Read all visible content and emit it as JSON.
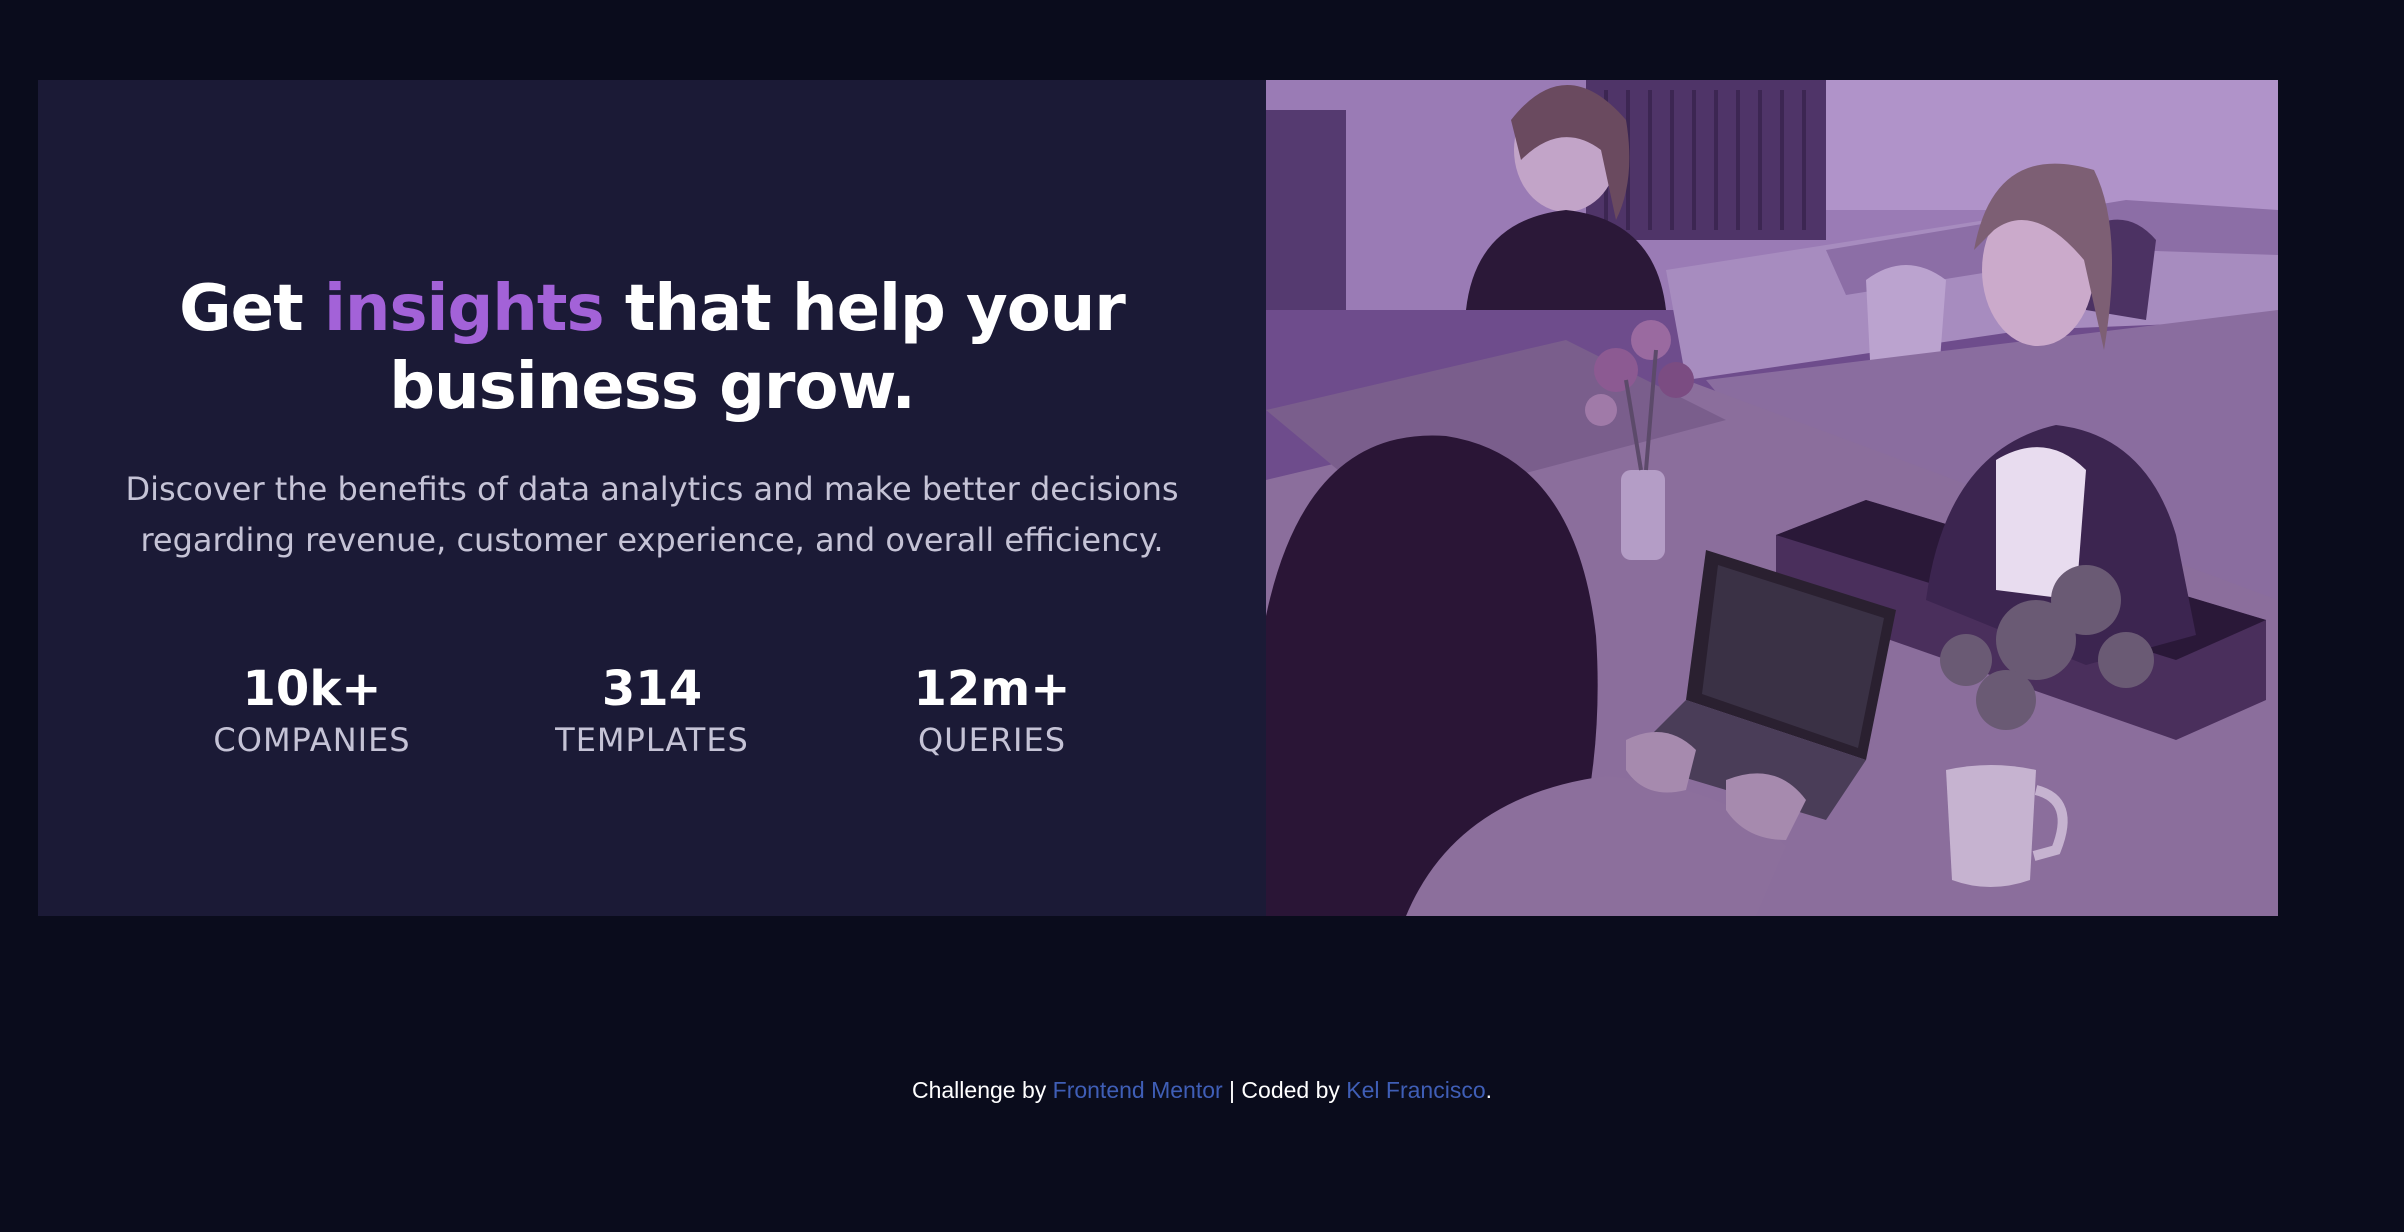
{
  "hero": {
    "headline_start": "Get ",
    "headline_accent": "insights",
    "headline_end": " that help your business grow.",
    "description": "Discover the benefits of data analytics and make better decisions regarding revenue, customer experience, and overall efficiency.",
    "accent_color": "#a362d8"
  },
  "stats": [
    {
      "value": "10k+",
      "label": "COMPANIES"
    },
    {
      "value": "314",
      "label": "TEMPLATES"
    },
    {
      "value": "12m+",
      "label": "QUERIES"
    }
  ],
  "photo": {
    "icon": "office-photo",
    "overlay_color": "#5d3c7a"
  },
  "footer": {
    "prefix": "Challenge by ",
    "link1": "Frontend Mentor",
    "middle": " | Coded by ",
    "link2": "Kel Francisco",
    "suffix": ".",
    "link_color": "#3f5eb6"
  },
  "colors": {
    "page_background": "#0a0c1c",
    "card_background": "#1b1a36"
  }
}
